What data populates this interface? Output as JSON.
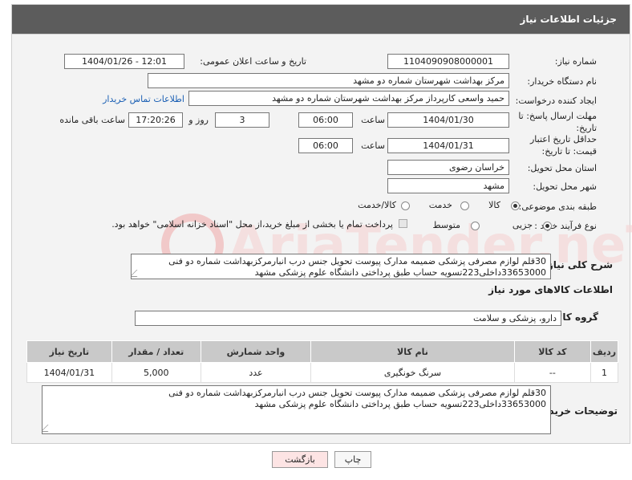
{
  "header": {
    "title": "جزئیات اطلاعات نیاز"
  },
  "labels": {
    "need_number": "شماره نیاز:",
    "announce_datetime": "تاریخ و ساعت اعلان عمومی:",
    "buyer_org": "نام دستگاه خریدار:",
    "creator": "ایجاد کننده درخواست:",
    "reply_deadline": "مهلت ارسال پاسخ: تا تاریخ:",
    "time": "ساعت",
    "days_and": "روز و",
    "time_remaining": "ساعت باقی مانده",
    "price_validity": "حداقل تاریخ اعتبار قیمت: تا تاریخ:",
    "delivery_province": "استان محل تحویل:",
    "delivery_city": "شهر محل تحویل:",
    "category": "طبقه بندی موضوعی:",
    "purchase_process": "نوع فرآیند خرید :",
    "general_description": "شرح کلی نیاز:",
    "goods_info": "اطلاعات کالاهای مورد نیاز",
    "goods_group": "گروه کالا:",
    "buyer_notes": "توضیحات خریدار:"
  },
  "fields": {
    "need_number": "1104090908000001",
    "announce_datetime": "1404/01/26 - 12:01",
    "buyer_org": "مرکز بهداشت شهرستان شماره دو مشهد",
    "creator": "حمید واسعی کارپرداز مرکز بهداشت شهرستان شماره دو مشهد",
    "reply_date": "1404/01/30",
    "reply_time": "06:00",
    "reply_days": "3",
    "reply_remaining": "17:20:26",
    "validity_date": "1404/01/31",
    "validity_time": "06:00",
    "province": "خراسان رضوی",
    "city": "مشهد",
    "goods_group": "دارو، پزشکی و سلامت"
  },
  "contact_link": "اطلاعات تماس خریدار",
  "category_options": [
    {
      "label": "کالا",
      "selected": true
    },
    {
      "label": "خدمت",
      "selected": false
    },
    {
      "label": "کالا/خدمت",
      "selected": false
    }
  ],
  "process_options": [
    {
      "label": "جزیی",
      "selected": true
    },
    {
      "label": "متوسط",
      "selected": false
    }
  ],
  "payment_note": "پرداخت تمام یا بخشی از مبلغ خرید،از محل \"اسناد خزانه اسلامی\" خواهد بود.",
  "description": {
    "line1": "30قلم لوازم مصرفی پزشکی ضمیمه مدارک پیوست تحویل جنس درب انبارمرکزبهداشت شماره دو فنی",
    "line2": "33653000داخلی223تسویه حساب طبق پرداختی دانشگاه علوم پزشکی مشهد"
  },
  "table": {
    "headers": [
      "ردیف",
      "کد کالا",
      "نام کالا",
      "واحد شمارش",
      "تعداد / مقدار",
      "تاریخ نیاز"
    ],
    "rows": [
      [
        "1",
        "--",
        "سرنگ خونگیری",
        "عدد",
        "5,000",
        "1404/01/31"
      ]
    ]
  },
  "notes": {
    "line1": "30قلم لوازم مصرفی پزشکی ضمیمه مدارک پیوست تحویل جنس درب انبارمرکزبهداشت شماره دو فنی",
    "line2": "33653000داخلی223تسویه حساب طبق پرداختی دانشگاه علوم پزشکی مشهد"
  },
  "buttons": {
    "print": "چاپ",
    "back": "بازگشت"
  },
  "watermark_text": "AriaTender.neT",
  "colors": {
    "header_bg": "#5c5c5c",
    "link": "#1a5fb4",
    "back_button": "#fde4e4",
    "table_header": "#c9c9c9"
  }
}
